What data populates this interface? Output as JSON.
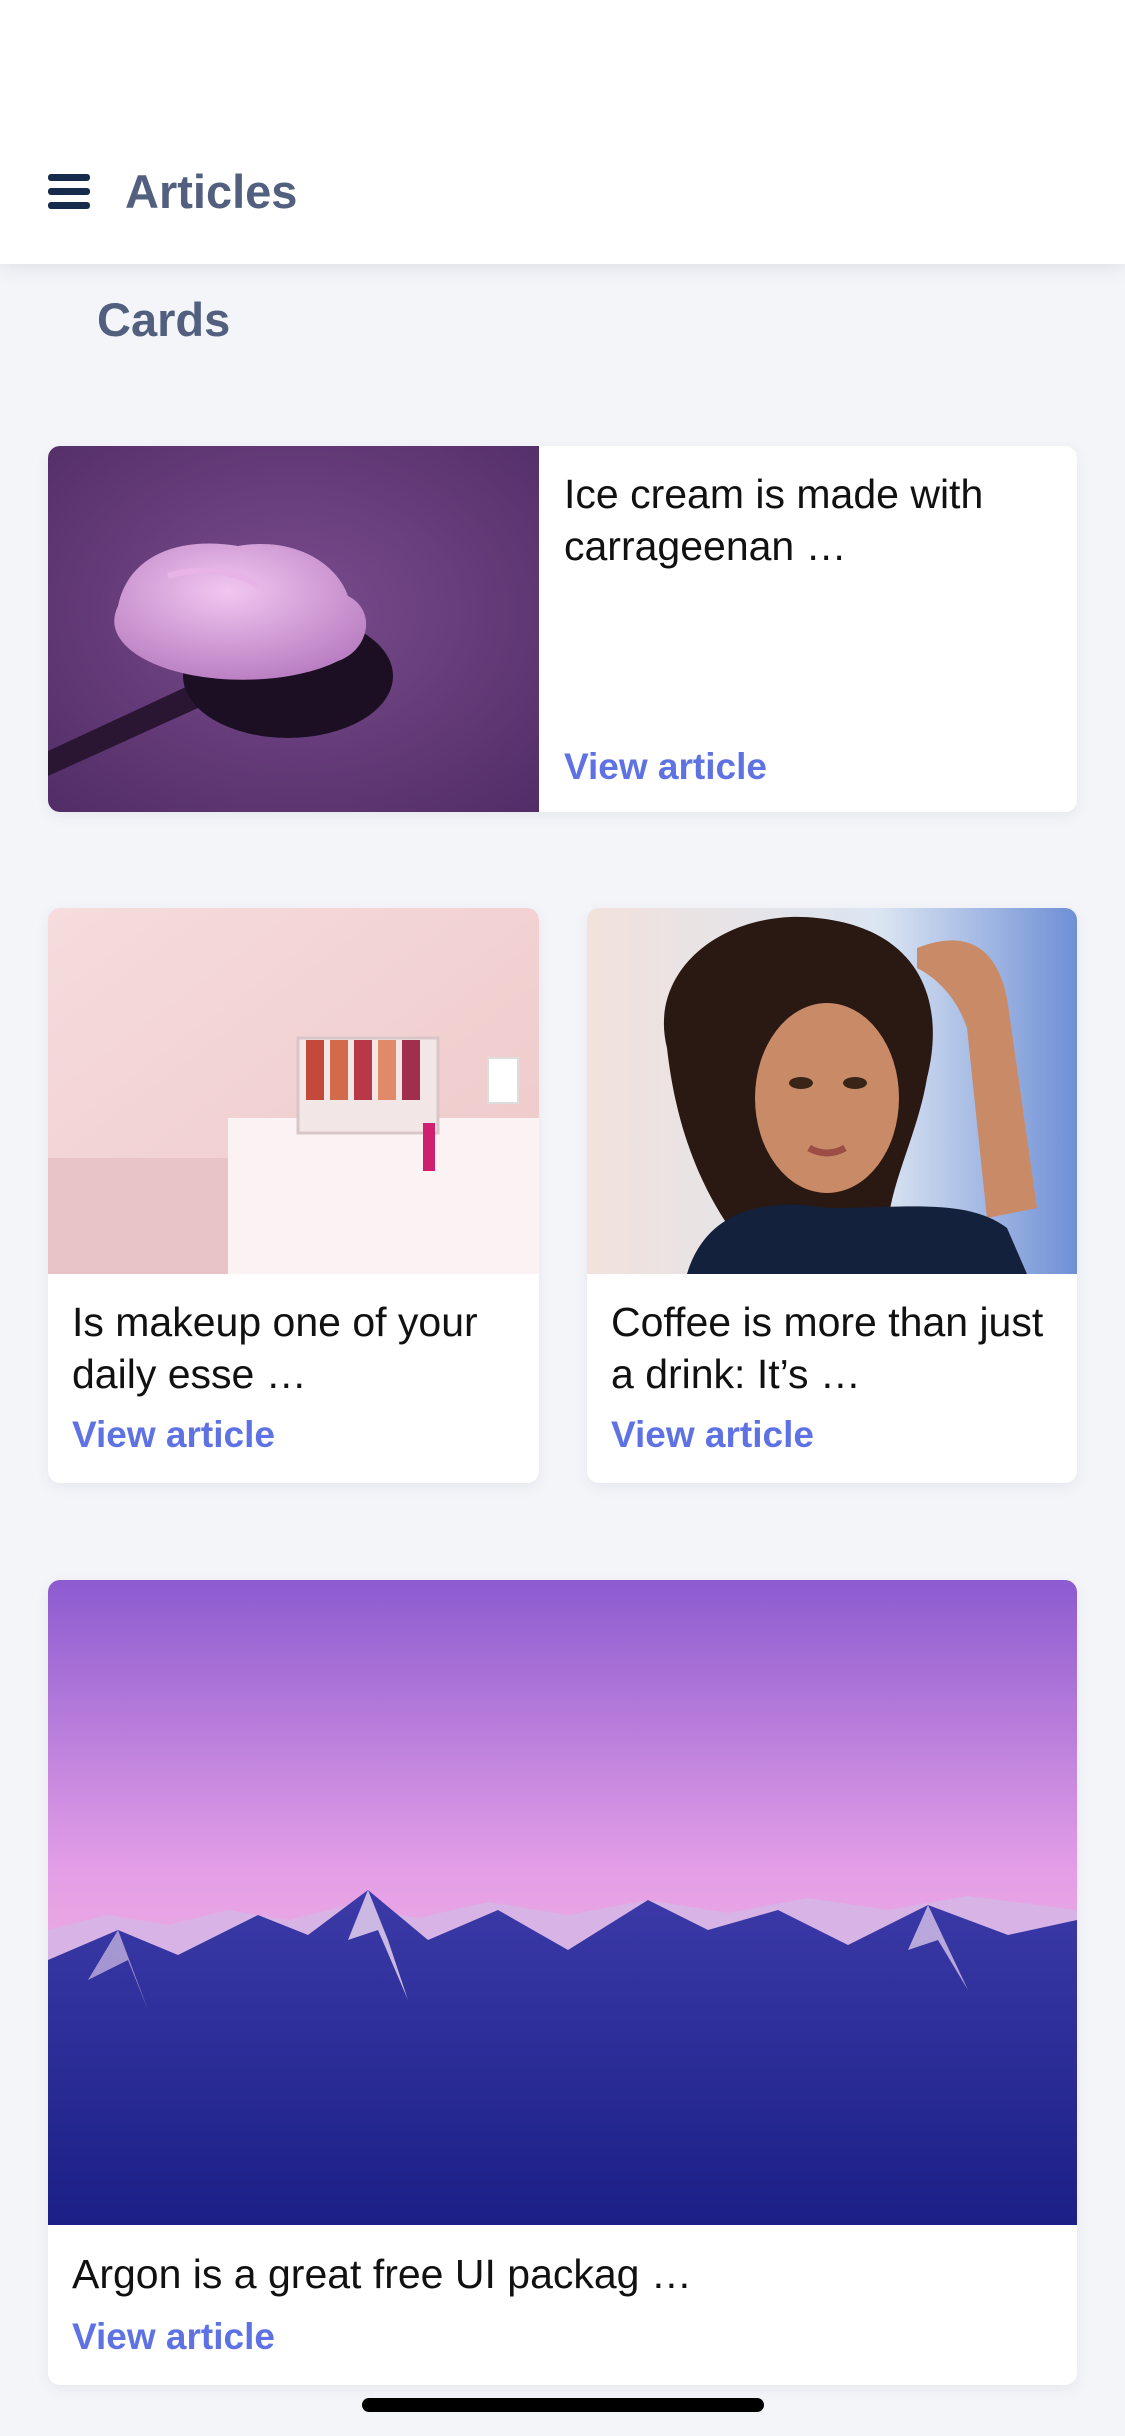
{
  "header": {
    "menu_icon": "hamburger-menu-icon",
    "title": "Articles"
  },
  "section": {
    "title": "Cards"
  },
  "cards": [
    {
      "title": "Ice cream is made with carrageenan …",
      "link": "View article",
      "image": "purple-ice-cream-scoop-photo"
    },
    {
      "title": "Is makeup one of your daily esse …",
      "link": "View article",
      "image": "pink-makeup-display-photo"
    },
    {
      "title": "Coffee is more than just a drink: It’s …",
      "link": "View article",
      "image": "curly-hair-woman-portrait-photo"
    },
    {
      "title": "Argon is a great free UI packag …",
      "link": "View article",
      "image": "purple-mountain-range-photo"
    }
  ],
  "colors": {
    "accent": "#5e72e4",
    "heading": "#525f7f",
    "background": "#f4f5f9"
  }
}
